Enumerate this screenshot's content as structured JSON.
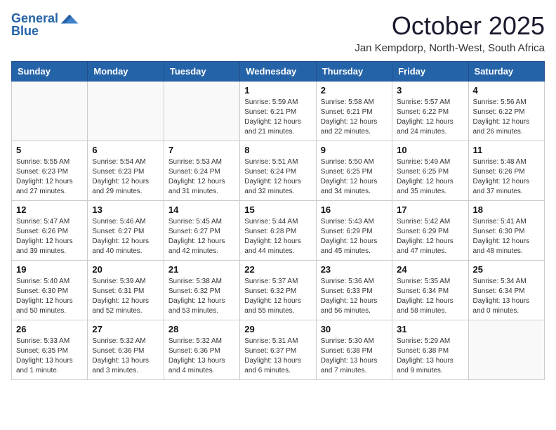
{
  "header": {
    "logo_line1": "General",
    "logo_line2": "Blue",
    "month": "October 2025",
    "location": "Jan Kempdorp, North-West, South Africa"
  },
  "weekdays": [
    "Sunday",
    "Monday",
    "Tuesday",
    "Wednesday",
    "Thursday",
    "Friday",
    "Saturday"
  ],
  "weeks": [
    [
      {
        "day": "",
        "info": ""
      },
      {
        "day": "",
        "info": ""
      },
      {
        "day": "",
        "info": ""
      },
      {
        "day": "1",
        "info": "Sunrise: 5:59 AM\nSunset: 6:21 PM\nDaylight: 12 hours\nand 21 minutes."
      },
      {
        "day": "2",
        "info": "Sunrise: 5:58 AM\nSunset: 6:21 PM\nDaylight: 12 hours\nand 22 minutes."
      },
      {
        "day": "3",
        "info": "Sunrise: 5:57 AM\nSunset: 6:22 PM\nDaylight: 12 hours\nand 24 minutes."
      },
      {
        "day": "4",
        "info": "Sunrise: 5:56 AM\nSunset: 6:22 PM\nDaylight: 12 hours\nand 26 minutes."
      }
    ],
    [
      {
        "day": "5",
        "info": "Sunrise: 5:55 AM\nSunset: 6:23 PM\nDaylight: 12 hours\nand 27 minutes."
      },
      {
        "day": "6",
        "info": "Sunrise: 5:54 AM\nSunset: 6:23 PM\nDaylight: 12 hours\nand 29 minutes."
      },
      {
        "day": "7",
        "info": "Sunrise: 5:53 AM\nSunset: 6:24 PM\nDaylight: 12 hours\nand 31 minutes."
      },
      {
        "day": "8",
        "info": "Sunrise: 5:51 AM\nSunset: 6:24 PM\nDaylight: 12 hours\nand 32 minutes."
      },
      {
        "day": "9",
        "info": "Sunrise: 5:50 AM\nSunset: 6:25 PM\nDaylight: 12 hours\nand 34 minutes."
      },
      {
        "day": "10",
        "info": "Sunrise: 5:49 AM\nSunset: 6:25 PM\nDaylight: 12 hours\nand 35 minutes."
      },
      {
        "day": "11",
        "info": "Sunrise: 5:48 AM\nSunset: 6:26 PM\nDaylight: 12 hours\nand 37 minutes."
      }
    ],
    [
      {
        "day": "12",
        "info": "Sunrise: 5:47 AM\nSunset: 6:26 PM\nDaylight: 12 hours\nand 39 minutes."
      },
      {
        "day": "13",
        "info": "Sunrise: 5:46 AM\nSunset: 6:27 PM\nDaylight: 12 hours\nand 40 minutes."
      },
      {
        "day": "14",
        "info": "Sunrise: 5:45 AM\nSunset: 6:27 PM\nDaylight: 12 hours\nand 42 minutes."
      },
      {
        "day": "15",
        "info": "Sunrise: 5:44 AM\nSunset: 6:28 PM\nDaylight: 12 hours\nand 44 minutes."
      },
      {
        "day": "16",
        "info": "Sunrise: 5:43 AM\nSunset: 6:29 PM\nDaylight: 12 hours\nand 45 minutes."
      },
      {
        "day": "17",
        "info": "Sunrise: 5:42 AM\nSunset: 6:29 PM\nDaylight: 12 hours\nand 47 minutes."
      },
      {
        "day": "18",
        "info": "Sunrise: 5:41 AM\nSunset: 6:30 PM\nDaylight: 12 hours\nand 48 minutes."
      }
    ],
    [
      {
        "day": "19",
        "info": "Sunrise: 5:40 AM\nSunset: 6:30 PM\nDaylight: 12 hours\nand 50 minutes."
      },
      {
        "day": "20",
        "info": "Sunrise: 5:39 AM\nSunset: 6:31 PM\nDaylight: 12 hours\nand 52 minutes."
      },
      {
        "day": "21",
        "info": "Sunrise: 5:38 AM\nSunset: 6:32 PM\nDaylight: 12 hours\nand 53 minutes."
      },
      {
        "day": "22",
        "info": "Sunrise: 5:37 AM\nSunset: 6:32 PM\nDaylight: 12 hours\nand 55 minutes."
      },
      {
        "day": "23",
        "info": "Sunrise: 5:36 AM\nSunset: 6:33 PM\nDaylight: 12 hours\nand 56 minutes."
      },
      {
        "day": "24",
        "info": "Sunrise: 5:35 AM\nSunset: 6:34 PM\nDaylight: 12 hours\nand 58 minutes."
      },
      {
        "day": "25",
        "info": "Sunrise: 5:34 AM\nSunset: 6:34 PM\nDaylight: 13 hours\nand 0 minutes."
      }
    ],
    [
      {
        "day": "26",
        "info": "Sunrise: 5:33 AM\nSunset: 6:35 PM\nDaylight: 13 hours\nand 1 minute."
      },
      {
        "day": "27",
        "info": "Sunrise: 5:32 AM\nSunset: 6:36 PM\nDaylight: 13 hours\nand 3 minutes."
      },
      {
        "day": "28",
        "info": "Sunrise: 5:32 AM\nSunset: 6:36 PM\nDaylight: 13 hours\nand 4 minutes."
      },
      {
        "day": "29",
        "info": "Sunrise: 5:31 AM\nSunset: 6:37 PM\nDaylight: 13 hours\nand 6 minutes."
      },
      {
        "day": "30",
        "info": "Sunrise: 5:30 AM\nSunset: 6:38 PM\nDaylight: 13 hours\nand 7 minutes."
      },
      {
        "day": "31",
        "info": "Sunrise: 5:29 AM\nSunset: 6:38 PM\nDaylight: 13 hours\nand 9 minutes."
      },
      {
        "day": "",
        "info": ""
      }
    ]
  ]
}
